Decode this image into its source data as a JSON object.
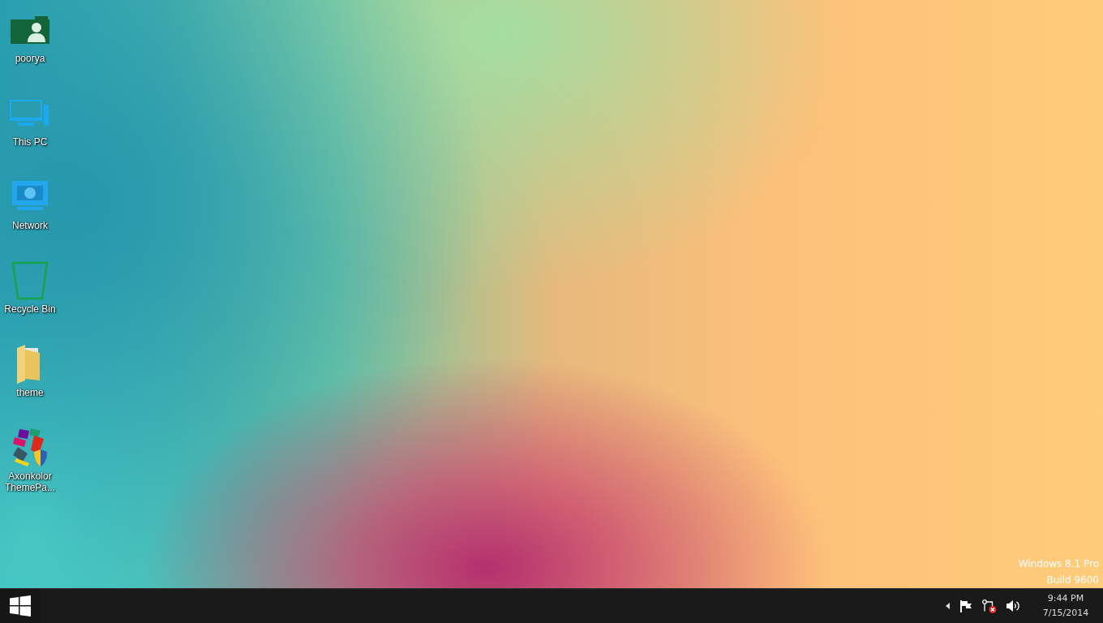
{
  "desktop_icons": [
    {
      "kind": "user",
      "label": "poorya"
    },
    {
      "kind": "pc",
      "label": "This PC"
    },
    {
      "kind": "network",
      "label": "Network"
    },
    {
      "kind": "recycle",
      "label": "Recycle Bin"
    },
    {
      "kind": "folder",
      "label": "theme"
    },
    {
      "kind": "installer",
      "label": "Axonkolor ThemePa..."
    }
  ],
  "os_watermark": [
    "Windows 8.1 Pro",
    "Build 9600"
  ],
  "taskbar": {
    "tray": [
      {
        "kind": "chevron"
      },
      {
        "kind": "flag"
      },
      {
        "kind": "network-error"
      },
      {
        "kind": "speaker"
      }
    ],
    "clock": {
      "time": "9:44 PM",
      "date": "7/15/2014"
    }
  }
}
